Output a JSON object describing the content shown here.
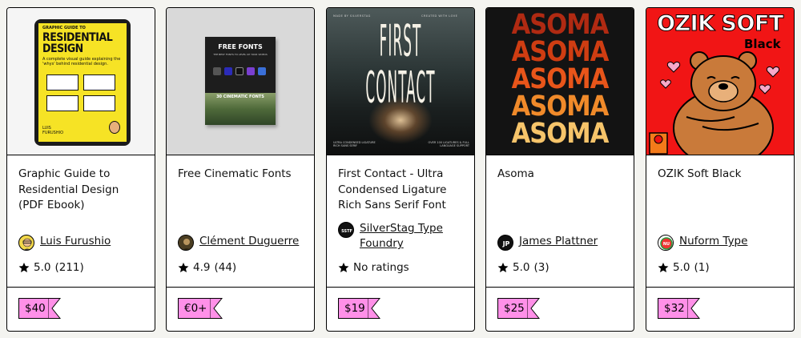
{
  "products": [
    {
      "title": "Graphic Guide to Residential Design (PDF Ebook)",
      "creator": "Luis Furushio",
      "rating": "5.0",
      "rating_count": "(211)",
      "price": "$40",
      "cover": {
        "kicker": "GRAPHIC GUIDE TO",
        "headline_1": "RESIDENTIAL",
        "headline_2": "DESIGN",
        "subtitle": "A complete visual guide explaining the 'whys' behind residential design.",
        "author_1": "LUIS",
        "author_2": "FURUSHIO"
      }
    },
    {
      "title": "Free Cinematic Fonts",
      "creator": "Clément Duguerre",
      "rating": "4.9",
      "rating_count": "(44)",
      "price": "€0+",
      "cover": {
        "headline": "FREE FONTS",
        "subtitle": "THE BEST FONTS TO LEVEL UP YOUR VIDEOS",
        "photo_label": "30 CINEMATIC FONTS"
      }
    },
    {
      "title": "First Contact - Ultra Condensed Ligature Rich Sans Serif Font",
      "creator": "SilverStag Type Foundry",
      "rating_text": "No ratings",
      "price": "$19",
      "cover": {
        "top_left": "MADE BY SILVERSTAG",
        "top_right": "CREATED WITH LOVE",
        "word_1": "FIRST",
        "word_2": "CONTACT",
        "bottom_left": "ULTRA CONDENSED LIGATURE RICH SANS SERIF",
        "bottom_right": "OVER 100 LIGATURES & FULL LANGUAGE SUPPORT"
      }
    },
    {
      "title": "Asoma",
      "creator": "James Plattner",
      "rating": "5.0",
      "rating_count": "(3)",
      "price": "$25",
      "cover": {
        "word": "ASOMA",
        "row_colors": [
          "#b02a12",
          "#cf3d12",
          "#e8551a",
          "#f08a2a",
          "#f6c46a"
        ]
      }
    },
    {
      "title": "OZIK Soft Black",
      "creator": "Nuform Type",
      "rating": "5.0",
      "rating_count": "(1)",
      "price": "$32",
      "cover": {
        "headline": "OZIK SOFT",
        "weight": "Black"
      }
    }
  ],
  "avatars": {
    "p3_initials": "SSTF",
    "p4_initials": "JP",
    "p5_initials": "NU"
  },
  "colors": {
    "price_tag": "#ff90e8",
    "page_bg": "#f4f4f0"
  }
}
